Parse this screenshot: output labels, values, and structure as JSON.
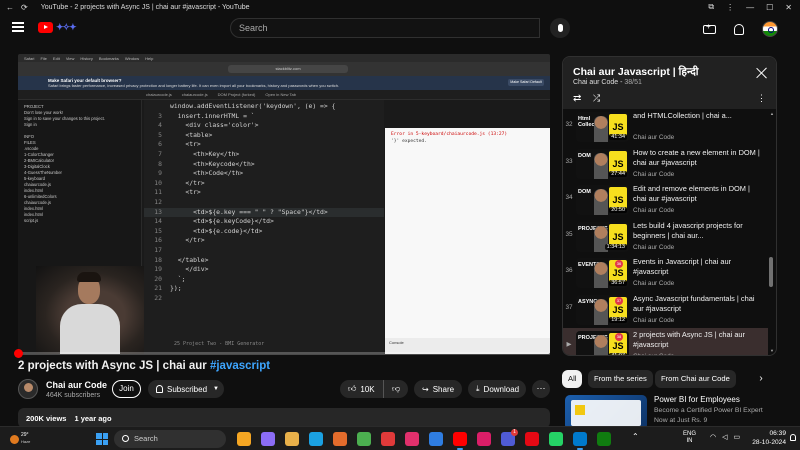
{
  "window": {
    "title": "YouTube - 2 projects with Async JS | chai aur #javascript - YouTube"
  },
  "header": {
    "search_placeholder": "Search"
  },
  "video": {
    "progress": 0.0,
    "screen": {
      "mac_menu": [
        "Safari",
        "File",
        "Edit",
        "View",
        "History",
        "Bookmarks",
        "Window",
        "Help"
      ],
      "url": "stackblitz.com",
      "notice_title": "Make Safari your default browser?",
      "notice_text": "Safari brings faster performance, increased privacy protection and longer battery life. It can even import all your bookmarks, history and passwords when you switch.",
      "notice_button": "Make Safari Default",
      "editor_tabs": [
        "chaiaurcode.js",
        "chaiaurcode.js",
        "DOM Project (forked)",
        "Open in New Tab"
      ],
      "sidebar_lines": [
        "PROJECT",
        "Don't lose your work!",
        "Sign in to save your changes to this project.",
        "Sign in",
        "",
        "INFO",
        "FILES",
        ".vscode",
        "1-ColorChanger",
        "2-BMICalculator",
        "3-DigitalClock",
        "4-GuessTheNumber",
        "5-keyboard",
        "chaiaurcode.js",
        "index.html",
        "6-unlimitedColors",
        "chaiaurcode.js",
        "index.html",
        "index.html",
        "script.js"
      ],
      "code": [
        {
          "n": "",
          "text": "window.addEventListener('keydown', (e) => {"
        },
        {
          "n": "3",
          "text": "  insert.innerHTML = `"
        },
        {
          "n": "4",
          "text": "    <div class='color'>"
        },
        {
          "n": "5",
          "text": "    <table>"
        },
        {
          "n": "6",
          "text": "    <tr>"
        },
        {
          "n": "7",
          "text": "      <th>Key</th>"
        },
        {
          "n": "8",
          "text": "      <th>Keycode</th>"
        },
        {
          "n": "9",
          "text": "      <th>Code</th>"
        },
        {
          "n": "10",
          "text": "    </tr>"
        },
        {
          "n": "11",
          "text": "    <tr>"
        },
        {
          "n": "12",
          "text": ""
        },
        {
          "n": "13",
          "text": "      <td>${e.key === \" \" ? \"Space\"}</td>"
        },
        {
          "n": "14",
          "text": "      <td>${e.keyCode}</td>"
        },
        {
          "n": "15",
          "text": "      <td>${e.code}</td>"
        },
        {
          "n": "16",
          "text": "    </tr>"
        },
        {
          "n": "17",
          "text": ""
        },
        {
          "n": "18",
          "text": "  </table>"
        },
        {
          "n": "19",
          "text": "    </div>"
        },
        {
          "n": "20",
          "text": "  `;"
        },
        {
          "n": "21",
          "text": "});"
        },
        {
          "n": "22",
          "text": ""
        }
      ],
      "active_line": 11,
      "error_title": "Error in 5-keyboard/chaiaurcode.js (13:27)",
      "error_msg": "'}' expected.",
      "bottom_code": "25    Project Two - BMI Generator",
      "console_label": "Console"
    }
  },
  "info": {
    "title_text": "2 projects with Async JS | chai aur ",
    "title_hashtag": "#javascript",
    "channel_name": "Chai aur Code",
    "subscribers": "464K subscribers",
    "join_label": "Join",
    "subscribed_label": "Subscribed",
    "likes": "10K",
    "share_label": "Share",
    "download_label": "Download",
    "views": "200K views",
    "age": "1 year ago"
  },
  "playlist": {
    "title": "Chai aur Javascript | हिन्दी",
    "channel": "Chai aur Code",
    "position": "38/51",
    "items": [
      {
        "index": "32",
        "word": "Html Collection",
        "badge": "",
        "duration": "41:34",
        "title": "and HTMLCollection | chai a...",
        "channel": "Chai aur Code"
      },
      {
        "index": "33",
        "word": "DOM",
        "badge": "",
        "duration": "27:44",
        "title": "How to create a new element in DOM | chai aur #javascript",
        "channel": "Chai aur Code"
      },
      {
        "index": "34",
        "word": "DOM",
        "badge": "",
        "duration": "20:50",
        "title": "Edit and remove elements in DOM | chai aur #javascript",
        "channel": "Chai aur Code"
      },
      {
        "index": "35",
        "word": "PROJECTS",
        "badge": "",
        "duration": "1:34:13",
        "title": "Lets build 4 javascript projects for beginners | chai aur...",
        "channel": "Chai aur Code"
      },
      {
        "index": "36",
        "word": "EVENTS",
        "badge": "36",
        "duration": "36:57",
        "title": "Events in Javascript | chai aur #javascript",
        "channel": "Chai aur Code"
      },
      {
        "index": "37",
        "word": "ASYNC",
        "badge": "37",
        "duration": "19:12",
        "title": "Async Javascript fundamentals | chai aur #javascript",
        "channel": "Chai aur Code"
      },
      {
        "index": "▶",
        "word": "PROJECTS",
        "badge": "38",
        "duration": "41:07",
        "title": "2 projects with Async JS | chai aur #javascript",
        "channel": "Chai aur Code",
        "current": true
      }
    ]
  },
  "chips": [
    "All",
    "From the series",
    "From Chai aur Code"
  ],
  "recommended": {
    "title": "Power BI for Employees",
    "line1": "Become a Certified Power BI Expert",
    "line2": "Now at Just Rs. 9"
  },
  "taskbar": {
    "weather_temp": "29°",
    "weather_desc": "Haze",
    "search_label": "Search",
    "lang": "ENG",
    "region": "IN",
    "time": "06:39",
    "date": "28-10-2024",
    "badge_count": "1",
    "colors": {
      "app1": "#f5a623",
      "app2": "#8b6cf5",
      "app3": "#e8b04a",
      "app4": "#1ba1e2",
      "app5": "#e46c2c",
      "app6": "#4caf50",
      "app7": "#e03a3a",
      "app8": "#e1306c",
      "app9": "#2f7de1",
      "app10": "#ff0000",
      "app11": "#db1e68",
      "app12": "#4f5bd5",
      "app13": "#e50914",
      "app14": "#25d366",
      "app15": "#007acc",
      "app16": "#107c10"
    }
  }
}
